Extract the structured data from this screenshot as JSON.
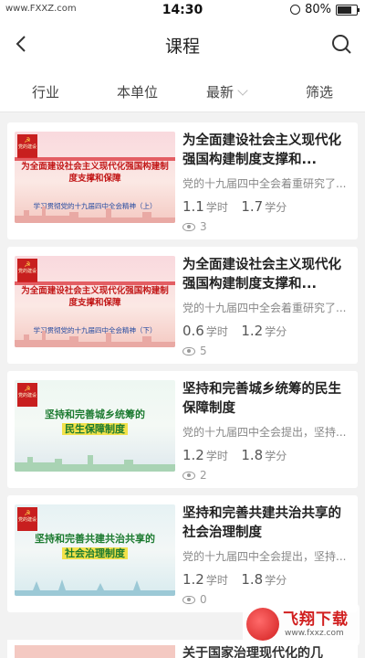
{
  "status_bar": {
    "carrier": "www.FXXZ.com",
    "time": "14:30",
    "battery": "80%",
    "battery_level": 0.8
  },
  "nav": {
    "title": "课程",
    "back_icon": "chevron-left-icon",
    "search_icon": "search-icon"
  },
  "filters": [
    {
      "label": "行业"
    },
    {
      "label": "本单位"
    },
    {
      "label": "最新"
    },
    {
      "label": "筛选"
    }
  ],
  "courses": [
    {
      "title": "为全面建设社会主义现代化强国构建制度支撑和...",
      "desc": "党的十九届四中全会着重研究了...",
      "hours": "1.1",
      "hours_unit": "学时",
      "credits": "1.7",
      "credits_unit": "学分",
      "views": "3",
      "thumb": {
        "tag": "党的建设",
        "line1": "为全面建设社会主义现代化强国构建制度支撑和保障",
        "line2": "学习贯彻党的十九届四中全会精神（上）"
      }
    },
    {
      "title": "为全面建设社会主义现代化强国构建制度支撑和...",
      "desc": "党的十九届四中全会着重研究了...",
      "hours": "0.6",
      "hours_unit": "学时",
      "credits": "1.2",
      "credits_unit": "学分",
      "views": "5",
      "thumb": {
        "tag": "党的建设",
        "line1": "为全面建设社会主义现代化强国构建制度支撑和保障",
        "line2": "学习贯彻党的十九届四中全会精神（下）"
      }
    },
    {
      "title": "坚持和完善城乡统筹的民生保障制度",
      "desc": "党的十九届四中全会提出，坚持...",
      "hours": "1.2",
      "hours_unit": "学时",
      "credits": "1.8",
      "credits_unit": "学分",
      "views": "2",
      "thumb": {
        "tag": "党的建设",
        "line1": "坚持和完善城乡统筹的",
        "line2": "民生保障制度"
      }
    },
    {
      "title": "坚持和完善共建共治共享的社会治理制度",
      "desc": "党的十九届四中全会提出，坚持...",
      "hours": "1.2",
      "hours_unit": "学时",
      "credits": "1.8",
      "credits_unit": "学分",
      "views": "0",
      "thumb": {
        "tag": "党的建设",
        "line1": "坚持和完善共建共治共享的",
        "line2": "社会治理制度"
      }
    }
  ],
  "partial_course": {
    "title": "关于国家治理现代化的几"
  },
  "watermark": {
    "title": "飞翔下载",
    "url": "www.fxxz.com"
  },
  "colors": {
    "accent_red": "#c81f1f",
    "text_dark": "#222222",
    "text_gray": "#888888"
  }
}
